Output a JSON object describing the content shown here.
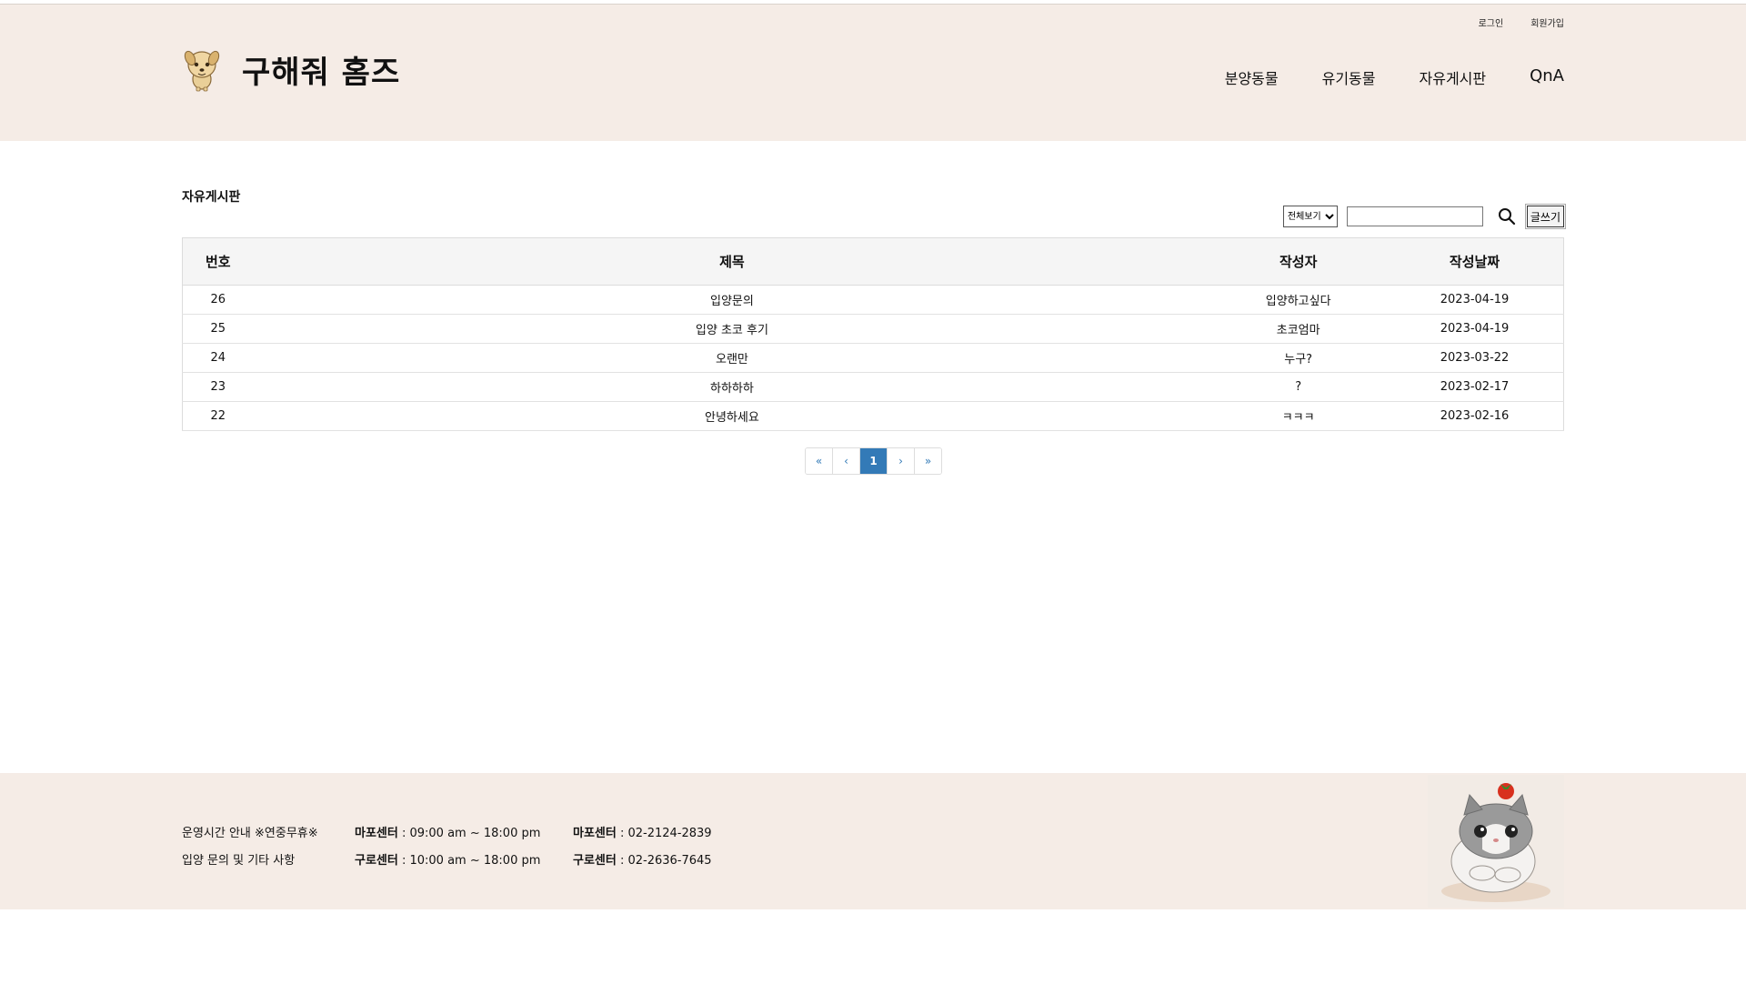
{
  "header": {
    "top_links": {
      "login": "로그인",
      "signup": "회원가입"
    },
    "logo_text": "구해줘 홈즈",
    "nav": [
      "분양동물",
      "유기동물",
      "자유게시판",
      "QnA"
    ]
  },
  "board": {
    "title": "자유게시판",
    "filter_selected": "전체보기",
    "search_placeholder": "",
    "write_label": "글쓰기",
    "columns": {
      "no": "번호",
      "title": "제목",
      "writer": "작성자",
      "date": "작성날짜"
    },
    "rows": [
      {
        "no": "26",
        "title": "입양문의",
        "writer": "입양하고싶다",
        "date": "2023-04-19"
      },
      {
        "no": "25",
        "title": "입양 초코 후기",
        "writer": "초코엄마",
        "date": "2023-04-19"
      },
      {
        "no": "24",
        "title": "오랜만",
        "writer": "누구?",
        "date": "2023-03-22"
      },
      {
        "no": "23",
        "title": "하하하하",
        "writer": "?",
        "date": "2023-02-17"
      },
      {
        "no": "22",
        "title": "안녕하세요",
        "writer": "ㅋㅋㅋ",
        "date": "2023-02-16"
      }
    ]
  },
  "pagination": {
    "first": "«",
    "prev": "‹",
    "current": "1",
    "next": "›",
    "last": "»"
  },
  "footer": {
    "hours_label": "운영시간 안내 ※연중무휴※",
    "inquiry_label": "입양 문의 및 기타 사항",
    "mapo_name": "마포센터",
    "mapo_hours": " : 09:00 am ~ 18:00 pm",
    "guro_name": "구로센터",
    "guro_hours": " : 10:00 am ~ 18:00 pm",
    "mapo_phone": " : 02-2124-2839",
    "guro_phone": " : 02-2636-7645"
  },
  "colors": {
    "header_bg": "#f5ece6",
    "pager_active": "#337ab7"
  },
  "icons": {
    "logo": "dog-mascot-icon",
    "search": "search-icon",
    "footer_image": "cat-illustration"
  }
}
